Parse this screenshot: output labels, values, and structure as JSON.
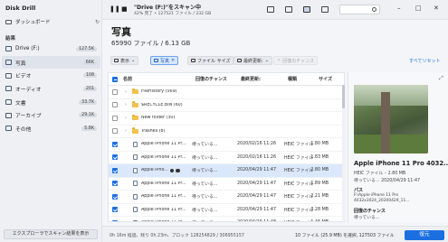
{
  "app": {
    "title": "Disk Drill"
  },
  "sidebar": {
    "dashboard": "ダッシュボード",
    "section": "結果",
    "items": [
      {
        "label": "Drive (F:)",
        "count": "127.5K",
        "active": false
      },
      {
        "label": "写真",
        "count": "66K",
        "active": true
      },
      {
        "label": "ビデオ",
        "count": "108",
        "active": false
      },
      {
        "label": "オーディオ",
        "count": "201",
        "active": false
      },
      {
        "label": "文書",
        "count": "33.7K",
        "active": false
      },
      {
        "label": "アーカイブ",
        "count": "29.1K",
        "active": false
      },
      {
        "label": "その他",
        "count": "5.8K",
        "active": false
      }
    ],
    "footer_button": "エクスプローラでスキャン結果を表示"
  },
  "topbar": {
    "scan_title": "\"Drive (F:)\"をスキャン中",
    "scan_sub": "42% 完了 • 127521 ファイル / 232 GB"
  },
  "main": {
    "title": "写真",
    "subtitle": "65990 ファイル / 6.13 GB",
    "filters": {
      "view": "表示",
      "photos": "写真",
      "file_size": "ファイル サイズ",
      "last_modified": "最終更新:",
      "recovery_chances": "回復のチャンス",
      "reset": "すべてリセット"
    },
    "columns": {
      "name": "名前",
      "chances": "回復のチャンス",
      "modified": "最終更新:",
      "type": "種類",
      "size": "サイズ"
    },
    "rows": [
      {
        "kind": "folder",
        "name": "FileHistory (569)",
        "chances": "",
        "modified": "",
        "type": "",
        "size": "",
        "checked": false,
        "selected": false
      },
      {
        "kind": "folder",
        "name": "$RECYCLE.BIN (60)",
        "chances": "",
        "modified": "",
        "type": "",
        "size": "",
        "checked": false,
        "selected": false
      },
      {
        "kind": "folder",
        "name": "New folder (30)",
        "chances": "",
        "modified": "",
        "type": "",
        "size": "",
        "checked": false,
        "selected": false
      },
      {
        "kind": "folder",
        "name": "Trashes (8)",
        "chances": "",
        "modified": "",
        "type": "",
        "size": "",
        "checked": false,
        "selected": false
      },
      {
        "kind": "file",
        "name": "Apple iPhone 11 Pr...",
        "chances": "待っている...",
        "modified": "2020/02/16 11:26",
        "type": "HEIC ファイル",
        "size": "1.80 MB",
        "checked": true,
        "selected": false
      },
      {
        "kind": "file",
        "name": "Apple iPhone 11 Pr...",
        "chances": "待っている...",
        "modified": "2020/02/16 11:26",
        "type": "HEIC ファイル",
        "size": "1.83 MB",
        "checked": true,
        "selected": false
      },
      {
        "kind": "file",
        "name": "Apple iPho...",
        "chances": "待っている...",
        "modified": "2020/04/29 11:47",
        "type": "HEIC ファイル",
        "size": "2.80 MB",
        "checked": true,
        "selected": true
      },
      {
        "kind": "file",
        "name": "Apple iPhone 11 Pr...",
        "chances": "待っている...",
        "modified": "2020/04/29 11:47",
        "type": "HEIC ファイル",
        "size": "1.89 MB",
        "checked": true,
        "selected": false
      },
      {
        "kind": "file",
        "name": "Apple iPhone 11 Pr...",
        "chances": "待っている...",
        "modified": "2020/04/29 11:47",
        "type": "HEIC ファイル",
        "size": "2.21 MB",
        "checked": true,
        "selected": false
      },
      {
        "kind": "file",
        "name": "Apple iPhone 11 Pr...",
        "chances": "待っている...",
        "modified": "2020/04/29 11:47",
        "type": "HEIC ファイル",
        "size": "3.28 MB",
        "checked": true,
        "selected": false
      },
      {
        "kind": "file",
        "name": "Apple iPhone 11 Pr...",
        "chances": "待っている...",
        "modified": "2020/04/29 11:48",
        "type": "HEIC ファイル",
        "size": "1.46 MB",
        "checked": true,
        "selected": false
      }
    ]
  },
  "preview": {
    "title": "Apple iPhone 11 Pro 4032...",
    "meta": "HEIC ファイル – 2.80 MB",
    "status": "待っている… 2020/04/29 11:47",
    "path_heading": "パス",
    "path": "F:\\Apple iPhone 11 Pro 4032x3024_20200429_11...",
    "chances_heading": "回復のチャンス",
    "chances": "待っている..."
  },
  "bottombar": {
    "eta": "0h 16m 経過、残り 0h 23m、ブロック 128254829 / 306955157",
    "selection": "10 ファイル (25.9 MB) を選択, 127503 ファイル",
    "recover": "復元"
  },
  "colors": {
    "accent": "#1b6fe0",
    "folder": "#f2c14e",
    "selected_row": "#dbe8fb"
  },
  "icons": [
    "pause-icon",
    "stop-icon",
    "list-view-icon",
    "folder-view-icon",
    "grid-view-icon",
    "preview-toggle-icon",
    "search-icon",
    "minimize-icon",
    "maximize-icon",
    "close-icon",
    "expand-icon"
  ]
}
